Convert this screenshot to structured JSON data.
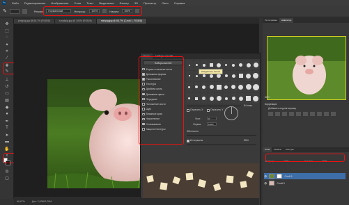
{
  "menubar": {
    "logo": "Ps",
    "items": [
      "Файл",
      "Редактирование",
      "Изображение",
      "Слои",
      "Текст",
      "Выделение",
      "Фильтр",
      "3D",
      "Просмотр",
      "Окно",
      "Справка"
    ]
  },
  "options": {
    "mode_label": "Режим:",
    "mode_value": "Нормальный",
    "opacity_label": "Непрозр.:",
    "opacity_value": "100%",
    "flow_label": "Нажим:",
    "flow_value": "100%"
  },
  "tabs": [
    {
      "label": "pinkpig.jpg @ 66,7% (RGB/8)",
      "active": false
    },
    {
      "label": "smallpig.jpg @ 100% (RGB/8)",
      "active": false
    },
    {
      "label": "minipig.jpg @ 66,7% (Слой 1, RGB/8)",
      "active": true
    }
  ],
  "brushpanel": {
    "tabs": [
      "Кисть",
      "Наборы кистей"
    ],
    "presets_button": "Наборы кистей",
    "items": [
      {
        "label": "Форма отпечатка кисти",
        "checked": false
      },
      {
        "label": "Динамика формы",
        "checked": true
      },
      {
        "label": "Рассеивание",
        "checked": true
      },
      {
        "label": "Текстура",
        "checked": false
      },
      {
        "label": "Двойная кисть",
        "checked": false
      },
      {
        "label": "Динамика цвета",
        "checked": true
      },
      {
        "label": "Передача",
        "checked": false
      },
      {
        "label": "Положение кисти",
        "checked": false
      },
      {
        "label": "Шум",
        "checked": false
      },
      {
        "label": "Влажные края",
        "checked": false
      },
      {
        "label": "Накопление",
        "checked": false
      },
      {
        "label": "Сглаживание",
        "checked": true
      },
      {
        "label": "Защита текстуры",
        "checked": false
      }
    ],
    "tooltip": "Квадратные листья",
    "flip_x": "Отразить X",
    "flip_y": "Отразить Y",
    "angle_label": "Угол:",
    "angle_value": "0°",
    "roundness_label": "Форма:",
    "roundness_value": "100%",
    "hardness_label": "Жёсткость",
    "spacing_label": "Интервалы",
    "spacing_value": "65%",
    "size_value": "84 пикс."
  },
  "navigator": {
    "tabs": [
      "Гистограмма",
      "Навигатор"
    ],
    "zoom": "66%"
  },
  "adjustments": {
    "title": "Коррекция",
    "subtitle": "Добавить корректировку"
  },
  "layers": {
    "tabs": [
      "Слои",
      "Каналы",
      "Контуры"
    ],
    "opacity_label": "Непрозр.:",
    "opacity_value": "100%",
    "fill_label": "Заливка:",
    "fill_value": "100%",
    "rows": [
      {
        "name": "Слой 1",
        "selected": true
      },
      {
        "name": "Слой 0",
        "selected": false
      }
    ]
  },
  "status": {
    "zoom": "66,67%",
    "doc": "Док: 2,00M/2,00M"
  },
  "colors": {
    "highlight_red": "#e11111",
    "selection_blue": "#3d6ea8"
  }
}
